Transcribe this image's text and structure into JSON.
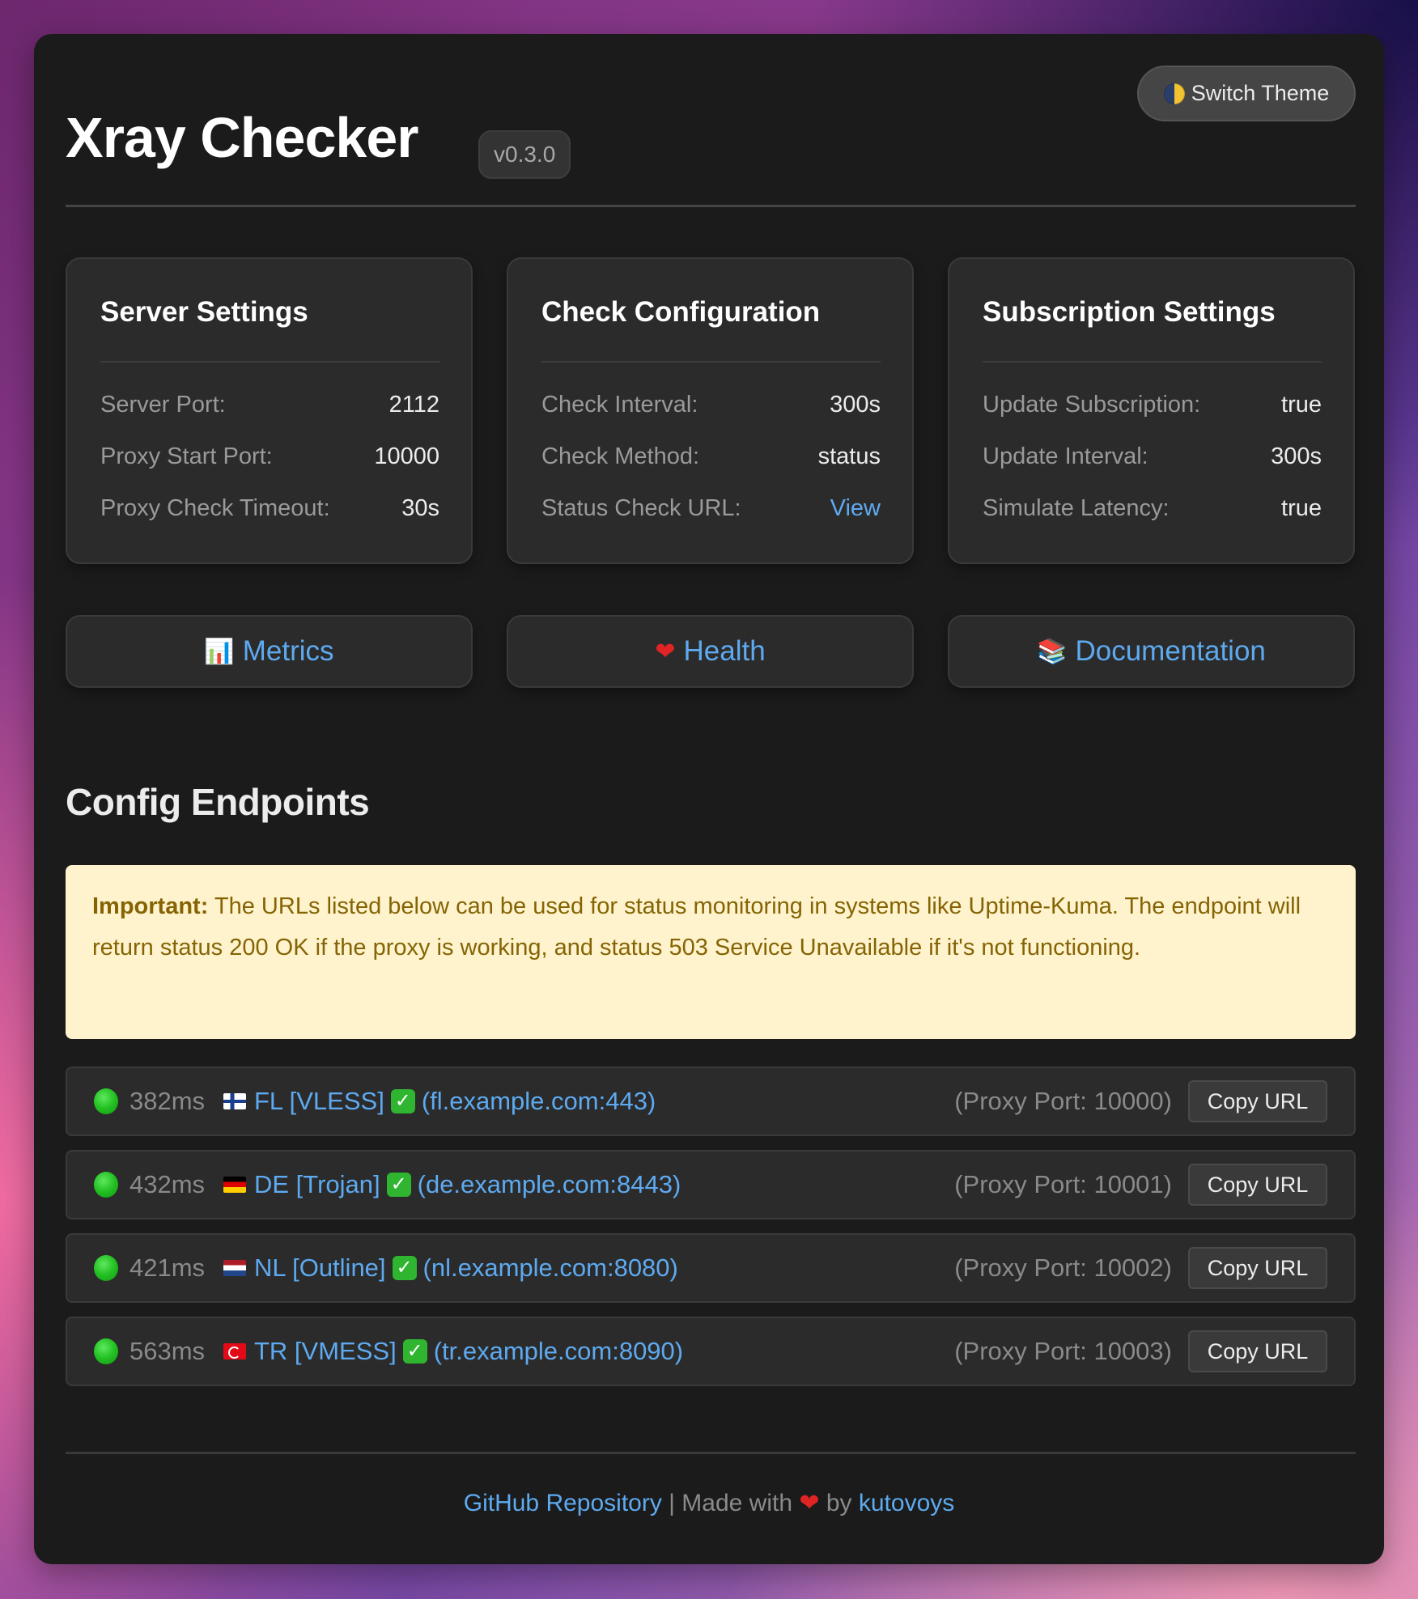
{
  "header": {
    "title": "Xray Checker",
    "version": "v0.3.0",
    "theme_button": {
      "icon": "half-moon-icon",
      "label": "Switch Theme"
    }
  },
  "cards": [
    {
      "title": "Server Settings",
      "rows": [
        {
          "label": "Server Port:",
          "value": "2112"
        },
        {
          "label": "Proxy Start Port:",
          "value": "10000"
        },
        {
          "label": "Proxy Check Timeout:",
          "value": "30s"
        }
      ]
    },
    {
      "title": "Check Configuration",
      "rows": [
        {
          "label": "Check Interval:",
          "value": "300s"
        },
        {
          "label": "Check Method:",
          "value": "status"
        },
        {
          "label": "Status Check URL:",
          "value": "View",
          "is_link": true
        }
      ]
    },
    {
      "title": "Subscription Settings",
      "rows": [
        {
          "label": "Update Subscription:",
          "value": "true"
        },
        {
          "label": "Update Interval:",
          "value": "300s"
        },
        {
          "label": "Simulate Latency:",
          "value": "true"
        }
      ]
    }
  ],
  "links": [
    {
      "icon": "bar-chart-icon",
      "emoji": "📊",
      "label": "Metrics"
    },
    {
      "icon": "heart-icon",
      "emoji": "❤",
      "label": "Health"
    },
    {
      "icon": "books-icon",
      "emoji": "📚",
      "label": "Documentation"
    }
  ],
  "endpoints_section": {
    "title": "Config Endpoints",
    "notice": {
      "strong": "Important:",
      "text": " The URLs listed below can be used for status monitoring in systems like Uptime-Kuma. The endpoint will return status 200 OK if the proxy is working, and status 503 Service Unavailable if it's not functioning."
    },
    "copy_label": "Copy URL",
    "items": [
      {
        "status": "online",
        "latency": "382ms",
        "flag": "fi",
        "name": "FL [VLESS]",
        "check": "✓",
        "host": "(fl.example.com:443)",
        "proxy_port": "(Proxy Port: 10000)"
      },
      {
        "status": "online",
        "latency": "432ms",
        "flag": "de",
        "name": "DE [Trojan]",
        "check": "✓",
        "host": "(de.example.com:8443)",
        "proxy_port": "(Proxy Port: 10001)"
      },
      {
        "status": "online",
        "latency": "421ms",
        "flag": "nl",
        "name": "NL [Outline]",
        "check": "✓",
        "host": "(nl.example.com:8080)",
        "proxy_port": "(Proxy Port: 10002)"
      },
      {
        "status": "online",
        "latency": "563ms",
        "flag": "tr",
        "name": "TR [VMESS]",
        "check": "✓",
        "host": "(tr.example.com:8090)",
        "proxy_port": "(Proxy Port: 10003)"
      }
    ]
  },
  "footer": {
    "repo_link": "GitHub Repository",
    "separator": " | Made with ",
    "heart": "❤",
    "by": " by ",
    "author": "kutovoys"
  },
  "colors": {
    "accent_link": "#5eaaf0",
    "status_ok": "#22c022",
    "notice_bg": "#fff3cd",
    "notice_text": "#856404",
    "panel_bg": "#1b1b1b",
    "card_bg": "#2b2b2b"
  }
}
